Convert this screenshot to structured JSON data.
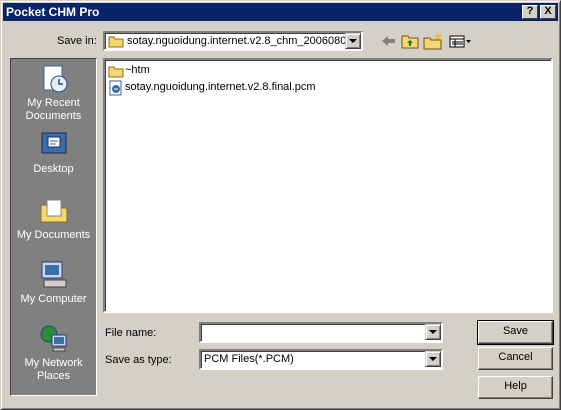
{
  "window": {
    "title": "Pocket CHM Pro",
    "help_btn": "?",
    "close_btn": "X"
  },
  "save_in": {
    "label": "Save in:",
    "value": "sotay.nguoidung.internet.v2.8_chm_2006080‹"
  },
  "places": [
    {
      "label": "My Recent Documents",
      "icon": "recent-documents-icon"
    },
    {
      "label": "Desktop",
      "icon": "desktop-icon"
    },
    {
      "label": "My Documents",
      "icon": "my-documents-icon"
    },
    {
      "label": "My Computer",
      "icon": "my-computer-icon"
    },
    {
      "label": "My Network Places",
      "icon": "network-places-icon"
    }
  ],
  "files": [
    {
      "name": "~htm",
      "icon": "folder-icon"
    },
    {
      "name": "sotay.nguoidung.internet.v2.8.final.pcm",
      "icon": "pcm-file-icon"
    }
  ],
  "file_name": {
    "label": "File name:",
    "value": ""
  },
  "save_as_type": {
    "label": "Save as type:",
    "value": "PCM Files(*.PCM)"
  },
  "buttons": {
    "save": "Save",
    "cancel": "Cancel",
    "help": "Help"
  },
  "colors": {
    "titlebar": "#0a246a",
    "face": "#d4d0c8",
    "places_bg": "#808080"
  }
}
